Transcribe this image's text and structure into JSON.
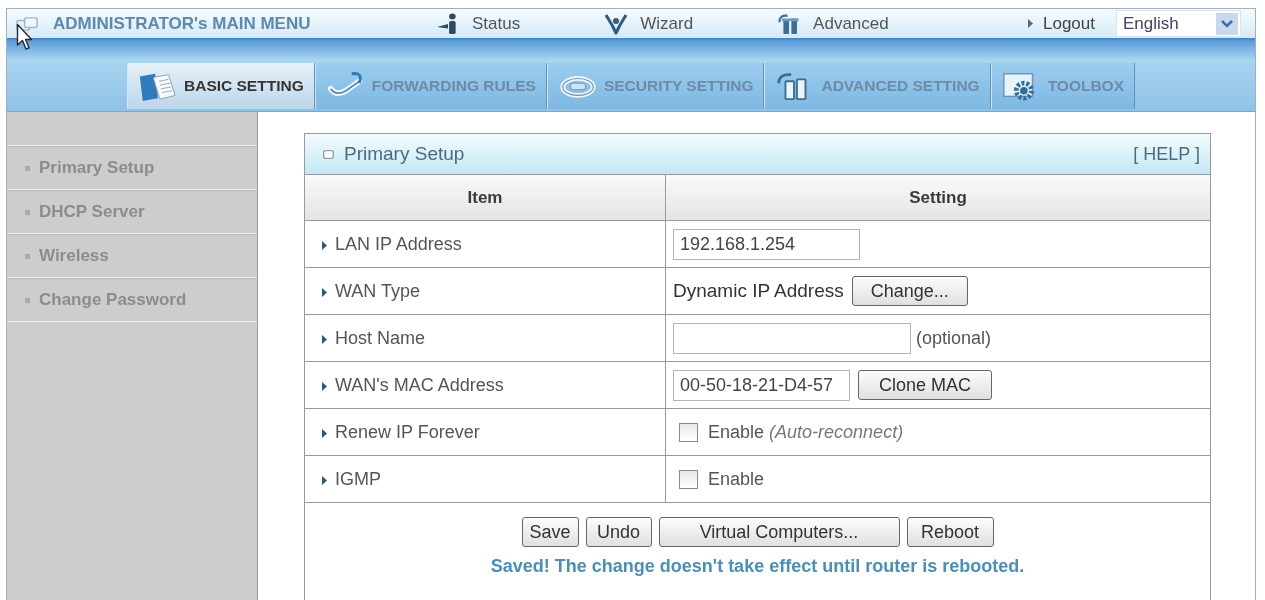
{
  "top_menu": {
    "title": "ADMINISTRATOR's MAIN MENU",
    "links": [
      {
        "label": "Status"
      },
      {
        "label": "Wizard"
      },
      {
        "label": "Advanced"
      }
    ],
    "logout": "Logout",
    "language": "English"
  },
  "tabs": [
    {
      "label": "BASIC SETTING",
      "selected": true
    },
    {
      "label": "FORWARDING RULES",
      "selected": false
    },
    {
      "label": "SECURITY SETTING",
      "selected": false
    },
    {
      "label": "ADVANCED SETTING",
      "selected": false
    },
    {
      "label": "TOOLBOX",
      "selected": false
    }
  ],
  "sidebar": {
    "items": [
      {
        "label": "Primary Setup"
      },
      {
        "label": "DHCP Server"
      },
      {
        "label": "Wireless"
      },
      {
        "label": "Change Password"
      }
    ]
  },
  "panel": {
    "title": "Primary Setup",
    "help": "[ HELP ]",
    "columns": [
      "Item",
      "Setting"
    ],
    "rows": [
      {
        "label": "LAN IP Address",
        "kind": "input",
        "value": "192.168.1.254"
      },
      {
        "label": "WAN Type",
        "kind": "text",
        "text": "Dynamic IP Address",
        "button": "Change..."
      },
      {
        "label": "Host Name",
        "kind": "input",
        "note": "(optional)"
      },
      {
        "label": "WAN's MAC Address",
        "kind": "input",
        "value": "00-50-18-21-D4-57",
        "button": "Clone MAC"
      },
      {
        "label": "Renew IP Forever",
        "kind": "checkbox",
        "checked": false,
        "text": "Enable",
        "note": "(Auto-reconnect)"
      },
      {
        "label": "IGMP",
        "kind": "checkbox",
        "checked": false,
        "text": "Enable"
      }
    ],
    "buttons": [
      "Save",
      "Undo",
      "Virtual Computers...",
      "Reboot"
    ],
    "message": "Saved! The change doesn't take effect until router is rebooted."
  }
}
